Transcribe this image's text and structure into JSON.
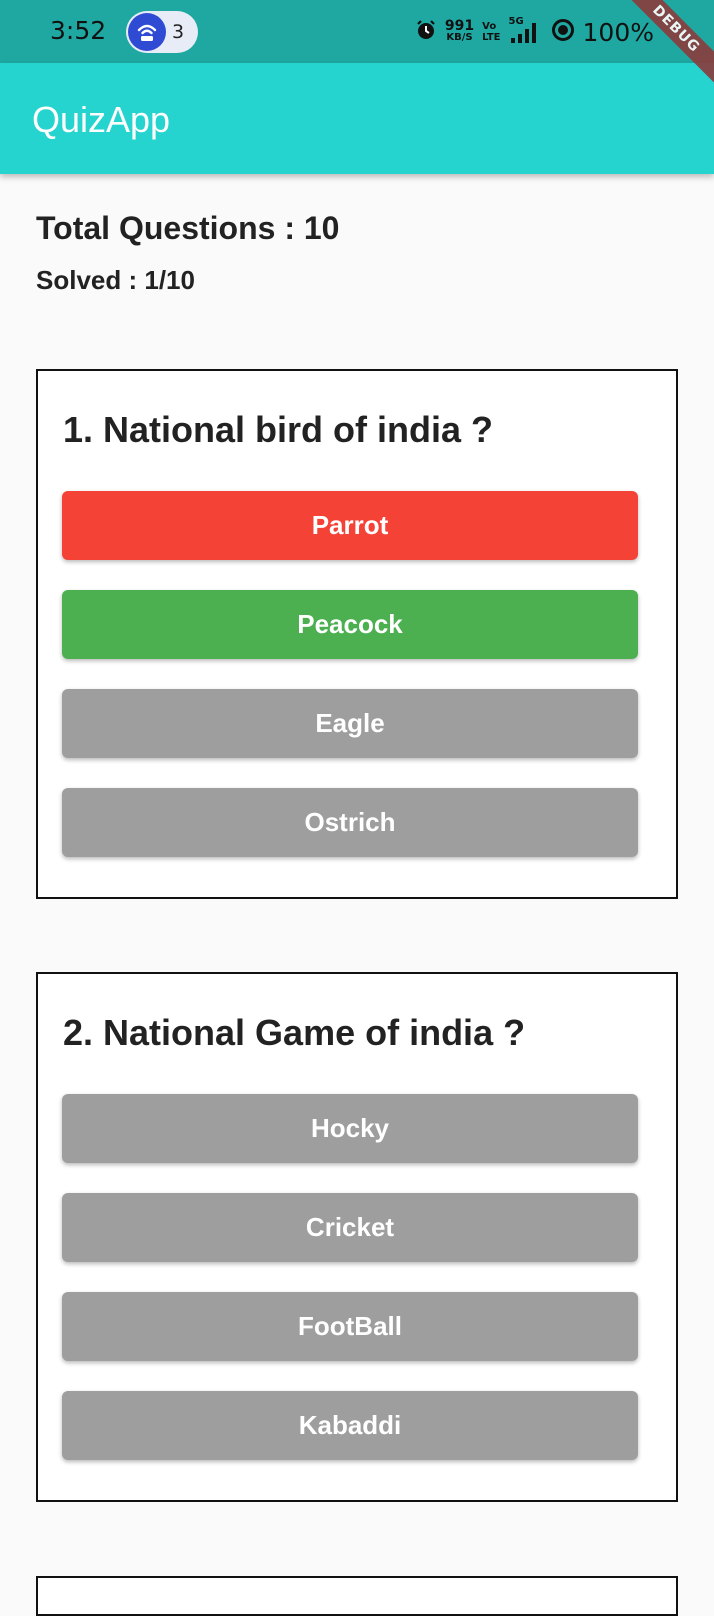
{
  "status_bar": {
    "time": "3:52",
    "notification_count": "3",
    "net_speed_value": "991",
    "net_speed_unit": "KB/S",
    "volte_top": "Vo",
    "volte_bottom": "LTE",
    "network_type": "5G",
    "battery": "100%",
    "background_color": "#1fa8a2"
  },
  "debug_banner": "DEBUG",
  "app_bar": {
    "title": "QuizApp",
    "color": "#26d4cf"
  },
  "summary": {
    "total_questions_text": "Total Questions : 10",
    "solved_text": "Solved : 1/10"
  },
  "questions": [
    {
      "title": "1. National bird of india ?",
      "options": [
        {
          "label": "Parrot",
          "state": "wrong",
          "color": "#f44336"
        },
        {
          "label": "Peacock",
          "state": "correct",
          "color": "#4caf50"
        },
        {
          "label": "Eagle",
          "state": "neutral",
          "color": "#9e9e9e"
        },
        {
          "label": "Ostrich",
          "state": "neutral",
          "color": "#9e9e9e"
        }
      ]
    },
    {
      "title": "2. National Game of india ?",
      "options": [
        {
          "label": "Hocky",
          "state": "neutral",
          "color": "#9e9e9e"
        },
        {
          "label": "Cricket",
          "state": "neutral",
          "color": "#9e9e9e"
        },
        {
          "label": "FootBall",
          "state": "neutral",
          "color": "#9e9e9e"
        },
        {
          "label": "Kabaddi",
          "state": "neutral",
          "color": "#9e9e9e"
        }
      ]
    }
  ]
}
